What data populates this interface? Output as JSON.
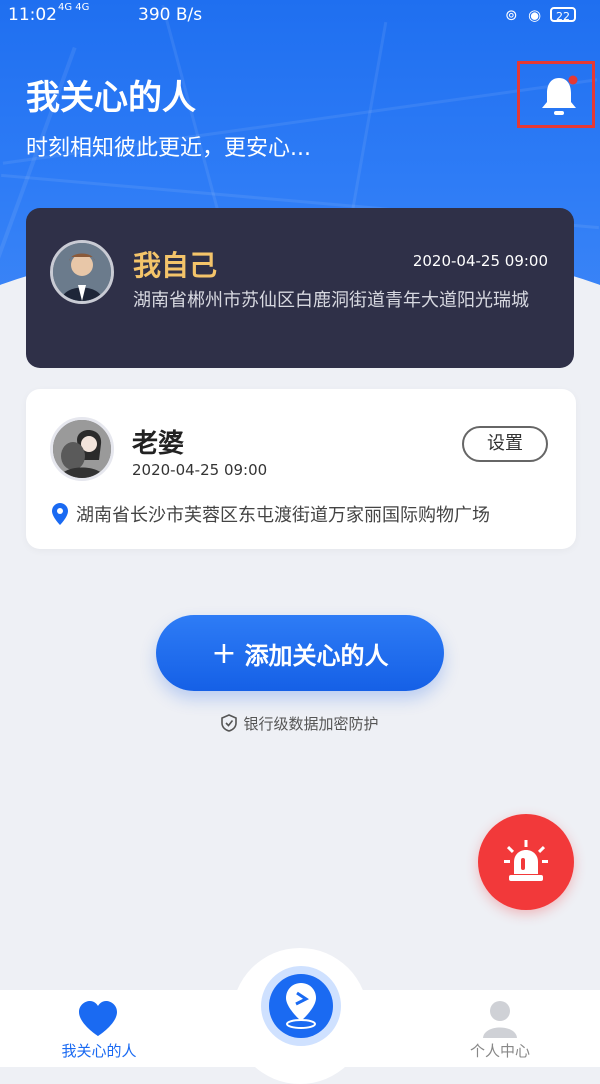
{
  "status_bar": {
    "time": "11:02",
    "network": "4G 4G",
    "speed": "390 B/s",
    "battery": "22"
  },
  "header": {
    "title": "我关心的人",
    "subtitle": "时刻相知彼此更近，更安心..."
  },
  "self_card": {
    "name": "我自己",
    "time": "2020-04-25 09:00",
    "address": "湖南省郴州市苏仙区白鹿洞街道青年大道阳光瑞城"
  },
  "contacts": [
    {
      "name": "老婆",
      "time": "2020-04-25 09:00",
      "settings_label": "设置",
      "address": "湖南省长沙市芙蓉区东屯渡街道万家丽国际购物广场"
    }
  ],
  "add_button": {
    "plus": "+",
    "label": "添加关心的人"
  },
  "security_note": "银行级数据加密防护",
  "tabs": [
    {
      "label": "我关心的人",
      "active": true
    },
    {
      "label": "个人中心",
      "active": false
    }
  ],
  "colors": {
    "primary": "#1a6af2",
    "self_card_bg": "#2f3048",
    "self_name": "#f4c46a",
    "sos": "#f2393a",
    "highlight_box": "#e53935"
  },
  "icons": [
    "bell-icon",
    "shield-icon",
    "location-pin-icon",
    "siren-icon",
    "heart-icon",
    "user-icon",
    "map-pin-icon"
  ]
}
